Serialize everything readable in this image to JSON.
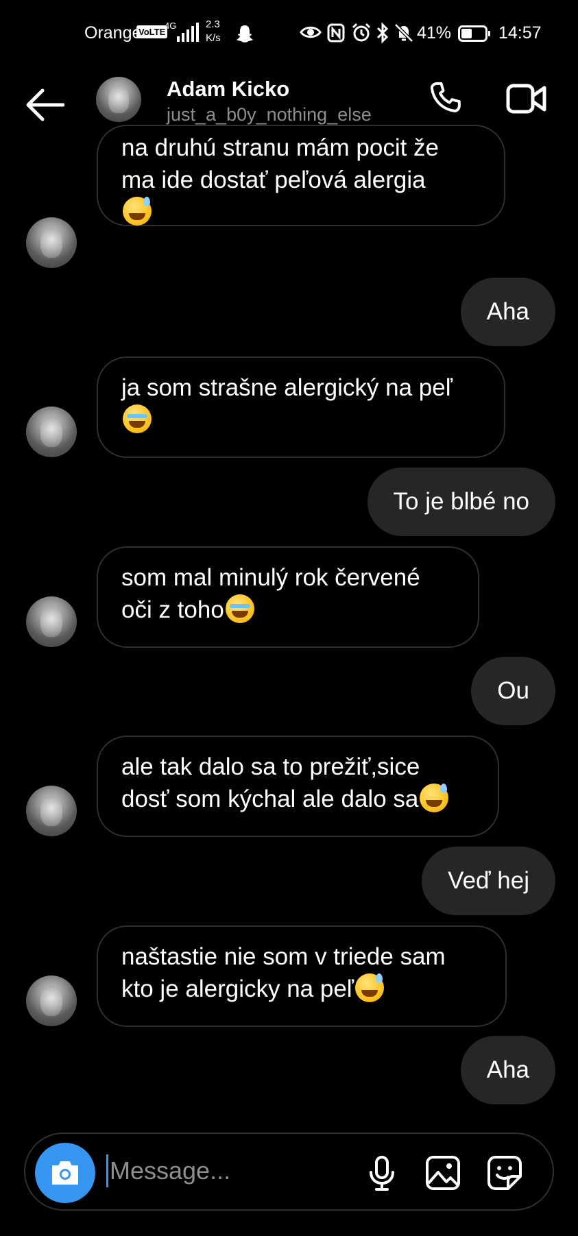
{
  "status_bar": {
    "carrier": "Orange",
    "volte": "VoLTE",
    "network": "4G",
    "speed_value": "2.3",
    "speed_unit": "K/s",
    "battery": "41%",
    "time": "14:57"
  },
  "header": {
    "name": "Adam Kicko",
    "username": "just_a_b0y_nothing_else"
  },
  "messages": [
    {
      "dir": "in",
      "lines": [
        "na druhú stranu mám pocit že",
        "ma ide dostať peľová alergia"
      ],
      "emoji": "sweat-smile"
    },
    {
      "dir": "out",
      "text": "Aha"
    },
    {
      "dir": "in",
      "lines": [
        "ja som strašne alergický na peľ"
      ],
      "emoji": "crying"
    },
    {
      "dir": "out",
      "text": "To je blbé no"
    },
    {
      "dir": "in",
      "lines": [
        "som mal minulý rok červené",
        "oči z toho"
      ],
      "emoji": "crying"
    },
    {
      "dir": "out",
      "text": "Ou"
    },
    {
      "dir": "in",
      "lines": [
        "ale tak dalo sa to prežiť,sice",
        "dosť som kýchal ale dalo sa"
      ],
      "emoji": "sweat-smile"
    },
    {
      "dir": "out",
      "text": "Veď hej"
    },
    {
      "dir": "in",
      "lines": [
        "naštastie nie som v triede sam",
        "kto je alergicky na peľ"
      ],
      "emoji": "sweat-smile"
    },
    {
      "dir": "out",
      "text": "Aha"
    }
  ],
  "composer": {
    "placeholder": "Message..."
  },
  "colors": {
    "background": "#000000",
    "outgoing_bubble": "#262626",
    "incoming_border": "#2f2f2f",
    "accent": "#3797f0",
    "muted_text": "#8e8e8e"
  }
}
